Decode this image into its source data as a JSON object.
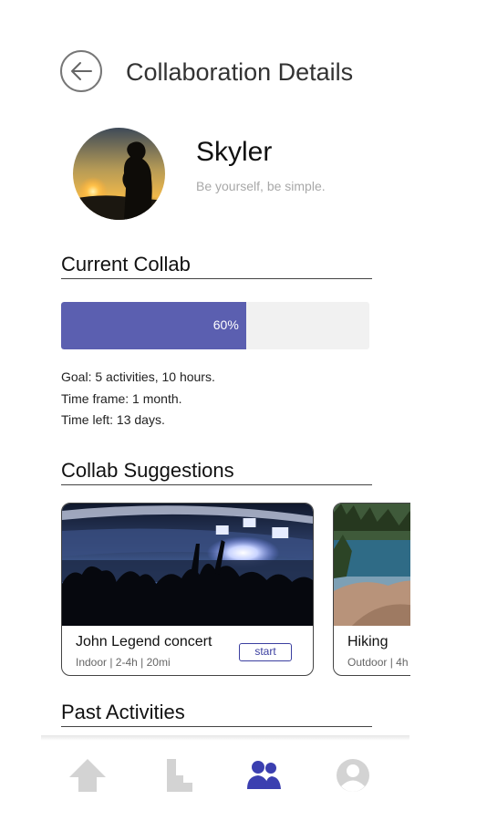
{
  "header": {
    "title": "Collaboration Details"
  },
  "profile": {
    "name": "Skyler",
    "bio": "Be yourself, be simple."
  },
  "current_collab": {
    "section_title": "Current Collab",
    "progress_percent": 60,
    "progress_label": "60%",
    "goal": "Goal: 5 activities, 10 hours.",
    "time_frame": "Time frame: 1 month.",
    "time_left": "Time left: 13 days."
  },
  "suggestions": {
    "section_title": "Collab Suggestions",
    "cards": [
      {
        "name": "John Legend concert",
        "meta": "Indoor | 2-4h | 20mi",
        "action": "start"
      },
      {
        "name": "Hiking",
        "meta": "Outdoor | 4h"
      }
    ]
  },
  "past": {
    "section_title": "Past Activities"
  },
  "nav": {
    "items": [
      {
        "icon": "home-icon",
        "active": false
      },
      {
        "icon": "chart-icon",
        "active": false
      },
      {
        "icon": "people-icon",
        "active": true
      },
      {
        "icon": "profile-icon",
        "active": false
      }
    ],
    "active_color": "#3b3fb0",
    "inactive_color": "#d3d3d3"
  },
  "colors": {
    "accent": "#5b5fb0",
    "progress_track": "#f1f1f1"
  }
}
